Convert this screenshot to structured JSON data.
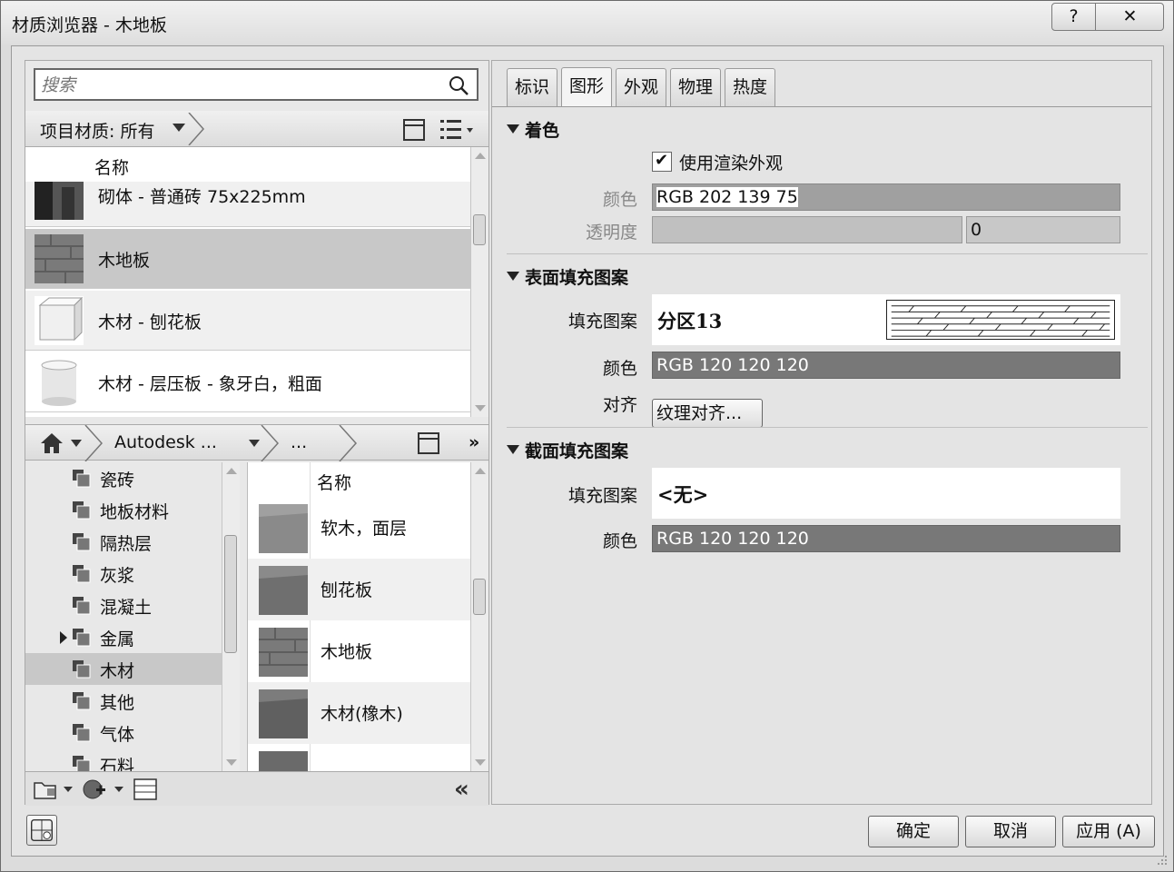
{
  "window": {
    "title": "材质浏览器 - 木地板",
    "help_label": "?",
    "close_label": "✕"
  },
  "search": {
    "placeholder": "搜索"
  },
  "library_bar": {
    "label": "项目材质: 所有"
  },
  "materials": {
    "header": "名称",
    "items": [
      {
        "name": "砌体 - 普通砖 75x225mm"
      },
      {
        "name": "木地板"
      },
      {
        "name": "木材 - 刨花板"
      },
      {
        "name": "木材 - 层压板 - 象牙白，粗面"
      }
    ]
  },
  "nav_bar": {
    "library": "Autodesk ...",
    "ellipsis": "...",
    "more": "»"
  },
  "tree": {
    "items": [
      {
        "label": "瓷砖"
      },
      {
        "label": "地板材料"
      },
      {
        "label": "隔热层"
      },
      {
        "label": "灰浆"
      },
      {
        "label": "混凝土"
      },
      {
        "label": "金属"
      },
      {
        "label": "木材"
      },
      {
        "label": "其他"
      },
      {
        "label": "气体"
      },
      {
        "label": "石料"
      }
    ]
  },
  "assets": {
    "header": "名称",
    "items": [
      {
        "name": "软木，面层"
      },
      {
        "name": "刨花板"
      },
      {
        "name": "木地板"
      },
      {
        "name": "木材(橡木)"
      }
    ]
  },
  "tabs": [
    {
      "label": "标识"
    },
    {
      "label": "图形"
    },
    {
      "label": "外观"
    },
    {
      "label": "物理"
    },
    {
      "label": "热度"
    }
  ],
  "shading": {
    "title": "着色",
    "use_render_label": "使用渲染外观",
    "color_label": "颜色",
    "color_value": "RGB 202 139 75",
    "transparency_label": "透明度",
    "transparency_value": "0"
  },
  "surface_pattern": {
    "title": "表面填充图案",
    "pattern_label": "填充图案",
    "pattern_value": "分区13",
    "color_label": "颜色",
    "color_value": "RGB 120 120 120",
    "align_label": "对齐",
    "align_button": "纹理对齐..."
  },
  "cut_pattern": {
    "title": "截面填充图案",
    "pattern_label": "填充图案",
    "pattern_value": "<无>",
    "color_label": "颜色",
    "color_value": "RGB 120 120 120"
  },
  "buttons": {
    "ok": "确定",
    "cancel": "取消",
    "apply": "应用 (A)"
  },
  "colors": {
    "selected_row": "#c8c8c8",
    "dark_field": "#787878"
  }
}
